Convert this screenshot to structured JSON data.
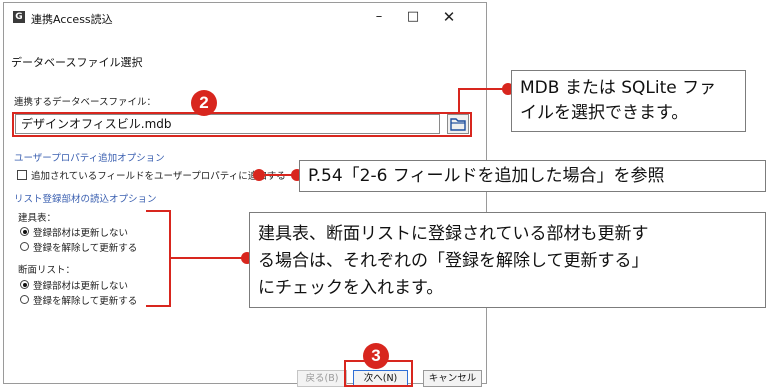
{
  "window": {
    "title": "連携Access読込",
    "app_icon": "G",
    "minimize": "–",
    "maximize": "□",
    "close": "✕"
  },
  "dialog": {
    "heading": "データベースファイル選択",
    "file_label": "連携するデータベースファイル：",
    "file_value": "デザインオフィスビル.mdb",
    "user_property_group": "ユーザープロパティ追加オプション",
    "user_property_checkbox": "追加されているフィールドをユーザープロパティに追加する",
    "list_group": "リスト登録部材の読込オプション",
    "fittings_label": "建具表：",
    "fittings_options": [
      "登録部材は更新しない",
      "登録を解除して更新する"
    ],
    "section_label": "断面リスト：",
    "section_options": [
      "登録部材は更新しない",
      "登録を解除して更新する"
    ]
  },
  "buttons": {
    "back": "戻る(B)",
    "next": "次へ(N)",
    "cancel": "キャンセル"
  },
  "annotations": {
    "badge_2": "2",
    "badge_3": "3",
    "callout_file_line1": "MDB または SQLite ファ",
    "callout_file_line2": "イルを選択できます。",
    "callout_property": "P.54「2-6 フィールドを追加した場合」を参照",
    "callout_list_line1": "建具表、断面リストに登録されている部材も更新す",
    "callout_list_line2": "る場合は、それぞれの「登録を解除して更新する」",
    "callout_list_line3": "にチェックを入れます。",
    "accent_color": "#d8261e"
  }
}
